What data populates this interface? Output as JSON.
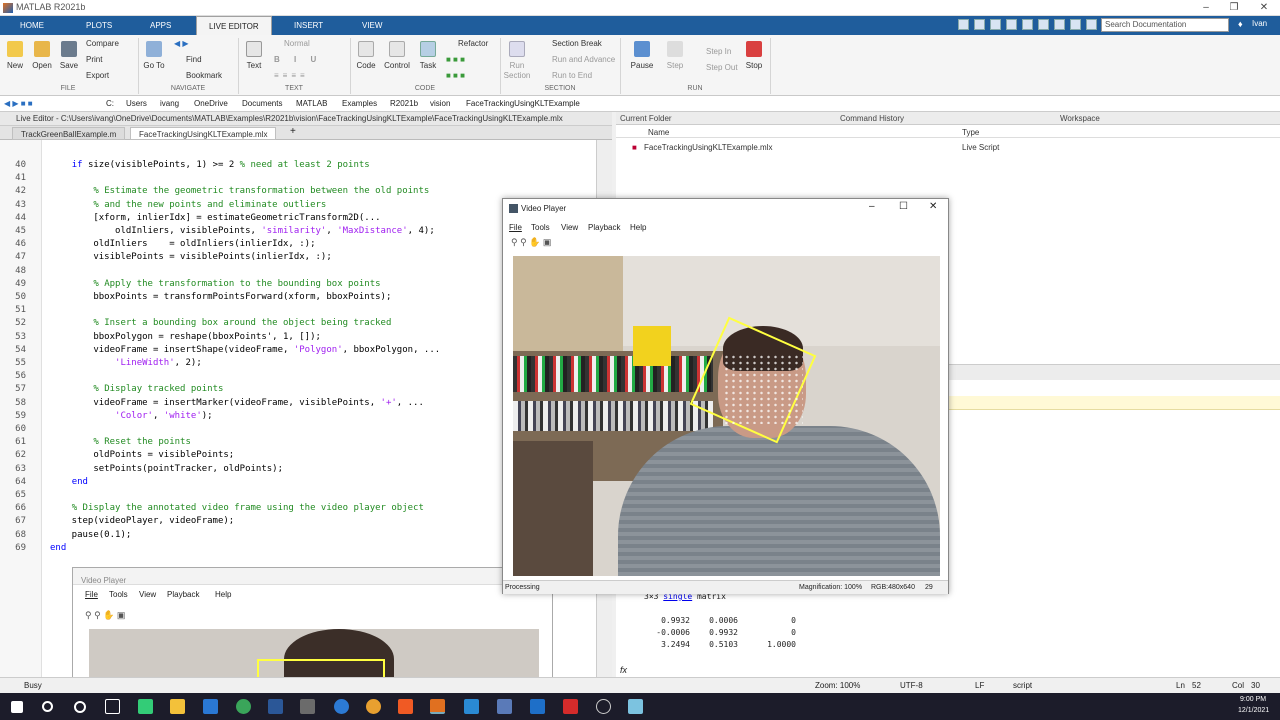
{
  "app": {
    "title": "MATLAB R2021b"
  },
  "tabs": [
    {
      "label": "HOME"
    },
    {
      "label": "PLOTS"
    },
    {
      "label": "APPS"
    },
    {
      "label": "LIVE EDITOR"
    },
    {
      "label": "INSERT"
    },
    {
      "label": "VIEW"
    }
  ],
  "search_placeholder": "Search Documentation",
  "user": "Ivan",
  "ribbon": {
    "file": {
      "new": "New",
      "open": "Open",
      "save": "Save",
      "compare": "Compare",
      "print": "Print",
      "export": "Export",
      "group": "FILE"
    },
    "navigate": {
      "goto": "Go To",
      "find": "Find",
      "bookmark": "Bookmark",
      "group": "NAVIGATE"
    },
    "text": {
      "text": "Text",
      "style": "Normal",
      "group": "TEXT"
    },
    "code": {
      "code": "Code",
      "control": "Control",
      "task": "Task",
      "refactor": "Refactor",
      "group": "CODE"
    },
    "section": {
      "run_section": "Run Section",
      "section_break": "Section Break",
      "run_advance": "Run and Advance",
      "run_end": "Run to End",
      "group": "SECTION"
    },
    "run": {
      "pause": "Pause",
      "step": "Step",
      "step_in": "Step In",
      "step_out": "Step Out",
      "stop": "Stop",
      "group": "RUN"
    }
  },
  "path": [
    "C:",
    "Users",
    "ivang",
    "OneDrive",
    "Documents",
    "MATLAB",
    "Examples",
    "R2021b",
    "vision",
    "FaceTrackingUsingKLTExample"
  ],
  "editor": {
    "header": "Live Editor - C:\\Users\\ivang\\OneDrive\\Documents\\MATLAB\\Examples\\R2021b\\vision\\FaceTrackingUsingKLTExample\\FaceTrackingUsingKLTExample.mlx",
    "tabs": [
      {
        "label": "TrackGreenBallExample.m"
      },
      {
        "label": "FaceTrackingUsingKLTExample.mlx"
      }
    ],
    "lines": [
      {
        "n": "40",
        "code": "    if size(visiblePoints, 1) >= 2 % need at least 2 points"
      },
      {
        "n": "41",
        "code": ""
      },
      {
        "n": "42",
        "code": "        % Estimate the geometric transformation between the old points"
      },
      {
        "n": "43",
        "code": "        % and the new points and eliminate outliers"
      },
      {
        "n": "44",
        "code": "        [xform, inlierIdx] = estimateGeometricTransform2D(..."
      },
      {
        "n": "45",
        "code": "            oldInliers, visiblePoints, 'similarity', 'MaxDistance', 4);"
      },
      {
        "n": "46",
        "code": "        oldInliers    = oldInliers(inlierIdx, :);"
      },
      {
        "n": "47",
        "code": "        visiblePoints = visiblePoints(inlierIdx, :);"
      },
      {
        "n": "48",
        "code": ""
      },
      {
        "n": "49",
        "code": "        % Apply the transformation to the bounding box points"
      },
      {
        "n": "50",
        "code": "        bboxPoints = transformPointsForward(xform, bboxPoints);"
      },
      {
        "n": "51",
        "code": ""
      },
      {
        "n": "52",
        "code": "        % Insert a bounding box around the object being tracked"
      },
      {
        "n": "53",
        "code": "        bboxPolygon = reshape(bboxPoints', 1, []);"
      },
      {
        "n": "54",
        "code": "        videoFrame = insertShape(videoFrame, 'Polygon', bboxPolygon, ..."
      },
      {
        "n": "55",
        "code": "            'LineWidth', 2);"
      },
      {
        "n": "56",
        "code": ""
      },
      {
        "n": "57",
        "code": "        % Display tracked points"
      },
      {
        "n": "58",
        "code": "        videoFrame = insertMarker(videoFrame, visiblePoints, '+', ..."
      },
      {
        "n": "59",
        "code": "            'Color', 'white');"
      },
      {
        "n": "60",
        "code": ""
      },
      {
        "n": "61",
        "code": "        % Reset the points"
      },
      {
        "n": "62",
        "code": "        oldPoints = visiblePoints;"
      },
      {
        "n": "63",
        "code": "        setPoints(pointTracker, oldPoints);"
      },
      {
        "n": "64",
        "code": "    end"
      },
      {
        "n": "65",
        "code": ""
      },
      {
        "n": "66",
        "code": "    % Display the annotated video frame using the video player object"
      },
      {
        "n": "67",
        "code": "    step(videoPlayer, videoFrame);"
      },
      {
        "n": "68",
        "code": "    pause(0.1);"
      },
      {
        "n": "69",
        "code": "end"
      }
    ]
  },
  "current_folder": {
    "title": "Current Folder",
    "col_name": "Name",
    "col_type": "Type",
    "file": "FaceTrackingUsingKLTExample.mlx",
    "file_type": "Live Script"
  },
  "command_history": {
    "title": "Command History"
  },
  "workspace": {
    "title": "Workspace"
  },
  "command_window": {
    "matrix_label_prefix": "3×3 ",
    "matrix_label_link": "single",
    "matrix_label_suffix": " matrix",
    "rows": [
      [
        "0.9932",
        "0.0006",
        "0"
      ],
      [
        "-0.0006",
        "0.9932",
        "0"
      ],
      [
        "3.2494",
        "0.5103",
        "1.0000"
      ]
    ],
    "prompt": "fx"
  },
  "video_player": {
    "title": "Video Player",
    "menus": [
      "File",
      "Tools",
      "View",
      "Playback",
      "Help"
    ],
    "status": "Processing",
    "magnification": "Magnification: 100%",
    "format": "RGB:480x640",
    "frame": "29"
  },
  "statusbar": {
    "busy": "Busy",
    "zoom": "Zoom: 100%",
    "encoding": "UTF-8",
    "eol": "LF",
    "mode": "script",
    "ln": "Ln",
    "ln_val": "52",
    "col": "Col",
    "col_val": "30"
  },
  "taskbar": {
    "time": "9:00 PM",
    "date": "12/1/2021"
  },
  "colors": {
    "tab_bar": "#1f5d9c",
    "comment": "#228b22",
    "string": "#a020f0",
    "keyword": "#0000ff",
    "track_box": "#ffff40"
  }
}
